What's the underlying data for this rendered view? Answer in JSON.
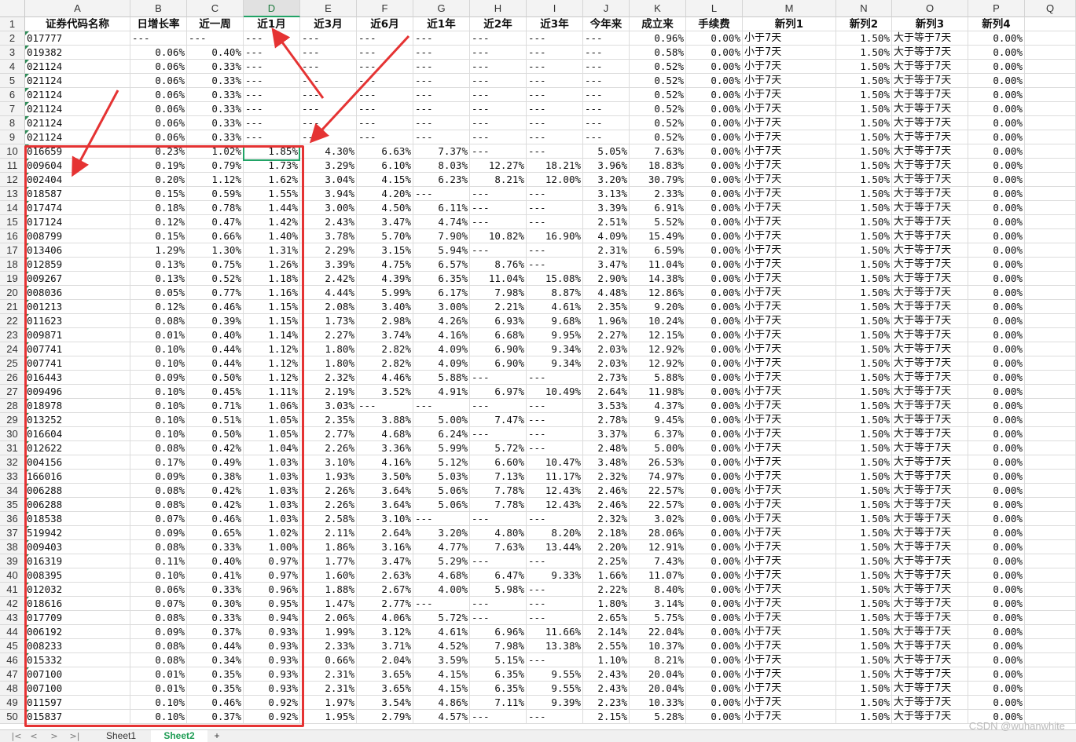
{
  "columns": [
    "A",
    "B",
    "C",
    "D",
    "E",
    "F",
    "G",
    "H",
    "I",
    "J",
    "K",
    "L",
    "M",
    "N",
    "O",
    "P",
    "Q"
  ],
  "active_column": "D",
  "header_row": [
    "证券代码名称",
    "日增长率",
    "近一周",
    "近1月",
    "近3月",
    "近6月",
    "近1年",
    "近2年",
    "近3年",
    "今年来",
    "成立来",
    "手续费",
    "新列1",
    "新列2",
    "新列3",
    "新列4"
  ],
  "rows": [
    [
      "017777",
      "---",
      "---",
      "---",
      "---",
      "---",
      "---",
      "---",
      "---",
      "---",
      "0.96%",
      "0.00%",
      "小于7天",
      "1.50%",
      "大于等于7天",
      "0.00%"
    ],
    [
      "019382",
      "0.06%",
      "0.40%",
      "---",
      "---",
      "---",
      "---",
      "---",
      "---",
      "---",
      "0.58%",
      "0.00%",
      "小于7天",
      "1.50%",
      "大于等于7天",
      "0.00%"
    ],
    [
      "021124",
      "0.06%",
      "0.33%",
      "---",
      "---",
      "---",
      "---",
      "---",
      "---",
      "---",
      "0.52%",
      "0.00%",
      "小于7天",
      "1.50%",
      "大于等于7天",
      "0.00%"
    ],
    [
      "021124",
      "0.06%",
      "0.33%",
      "---",
      "---",
      "---",
      "---",
      "---",
      "---",
      "---",
      "0.52%",
      "0.00%",
      "小于7天",
      "1.50%",
      "大于等于7天",
      "0.00%"
    ],
    [
      "021124",
      "0.06%",
      "0.33%",
      "---",
      "---",
      "---",
      "---",
      "---",
      "---",
      "---",
      "0.52%",
      "0.00%",
      "小于7天",
      "1.50%",
      "大于等于7天",
      "0.00%"
    ],
    [
      "021124",
      "0.06%",
      "0.33%",
      "---",
      "---",
      "---",
      "---",
      "---",
      "---",
      "---",
      "0.52%",
      "0.00%",
      "小于7天",
      "1.50%",
      "大于等于7天",
      "0.00%"
    ],
    [
      "021124",
      "0.06%",
      "0.33%",
      "---",
      "---",
      "---",
      "---",
      "---",
      "---",
      "---",
      "0.52%",
      "0.00%",
      "小于7天",
      "1.50%",
      "大于等于7天",
      "0.00%"
    ],
    [
      "021124",
      "0.06%",
      "0.33%",
      "---",
      "---",
      "---",
      "---",
      "---",
      "---",
      "---",
      "0.52%",
      "0.00%",
      "小于7天",
      "1.50%",
      "大于等于7天",
      "0.00%"
    ],
    [
      "016659",
      "0.23%",
      "1.02%",
      "1.85%",
      "4.30%",
      "6.63%",
      "7.37%",
      "---",
      "---",
      "5.05%",
      "7.63%",
      "0.00%",
      "小于7天",
      "1.50%",
      "大于等于7天",
      "0.00%"
    ],
    [
      "009604",
      "0.19%",
      "0.79%",
      "1.73%",
      "3.29%",
      "6.10%",
      "8.03%",
      "12.27%",
      "18.21%",
      "3.96%",
      "18.83%",
      "0.00%",
      "小于7天",
      "1.50%",
      "大于等于7天",
      "0.00%"
    ],
    [
      "002404",
      "0.20%",
      "1.12%",
      "1.62%",
      "3.04%",
      "4.15%",
      "6.23%",
      "8.21%",
      "12.00%",
      "3.20%",
      "30.79%",
      "0.00%",
      "小于7天",
      "1.50%",
      "大于等于7天",
      "0.00%"
    ],
    [
      "018587",
      "0.15%",
      "0.59%",
      "1.55%",
      "3.94%",
      "4.20%",
      "---",
      "---",
      "---",
      "3.13%",
      "2.33%",
      "0.00%",
      "小于7天",
      "1.50%",
      "大于等于7天",
      "0.00%"
    ],
    [
      "017474",
      "0.18%",
      "0.78%",
      "1.44%",
      "3.00%",
      "4.50%",
      "6.11%",
      "---",
      "---",
      "3.39%",
      "6.91%",
      "0.00%",
      "小于7天",
      "1.50%",
      "大于等于7天",
      "0.00%"
    ],
    [
      "017124",
      "0.12%",
      "0.47%",
      "1.42%",
      "2.43%",
      "3.47%",
      "4.74%",
      "---",
      "---",
      "2.51%",
      "5.52%",
      "0.00%",
      "小于7天",
      "1.50%",
      "大于等于7天",
      "0.00%"
    ],
    [
      "008799",
      "0.15%",
      "0.66%",
      "1.40%",
      "3.78%",
      "5.70%",
      "7.90%",
      "10.82%",
      "16.90%",
      "4.09%",
      "15.49%",
      "0.00%",
      "小于7天",
      "1.50%",
      "大于等于7天",
      "0.00%"
    ],
    [
      "013406",
      "1.29%",
      "1.30%",
      "1.31%",
      "2.29%",
      "3.15%",
      "5.94%",
      "---",
      "---",
      "2.31%",
      "6.59%",
      "0.00%",
      "小于7天",
      "1.50%",
      "大于等于7天",
      "0.00%"
    ],
    [
      "012859",
      "0.13%",
      "0.75%",
      "1.26%",
      "3.39%",
      "4.75%",
      "6.57%",
      "8.76%",
      "---",
      "3.47%",
      "11.04%",
      "0.00%",
      "小于7天",
      "1.50%",
      "大于等于7天",
      "0.00%"
    ],
    [
      "009267",
      "0.13%",
      "0.52%",
      "1.18%",
      "2.42%",
      "4.39%",
      "6.35%",
      "11.04%",
      "15.08%",
      "2.90%",
      "14.38%",
      "0.00%",
      "小于7天",
      "1.50%",
      "大于等于7天",
      "0.00%"
    ],
    [
      "008036",
      "0.05%",
      "0.77%",
      "1.16%",
      "4.44%",
      "5.99%",
      "6.17%",
      "7.98%",
      "8.87%",
      "4.48%",
      "12.86%",
      "0.00%",
      "小于7天",
      "1.50%",
      "大于等于7天",
      "0.00%"
    ],
    [
      "001213",
      "0.12%",
      "0.46%",
      "1.15%",
      "2.08%",
      "3.40%",
      "3.00%",
      "2.21%",
      "4.61%",
      "2.35%",
      "9.20%",
      "0.00%",
      "小于7天",
      "1.50%",
      "大于等于7天",
      "0.00%"
    ],
    [
      "011623",
      "0.08%",
      "0.39%",
      "1.15%",
      "1.73%",
      "2.98%",
      "4.26%",
      "6.93%",
      "9.68%",
      "1.96%",
      "10.24%",
      "0.00%",
      "小于7天",
      "1.50%",
      "大于等于7天",
      "0.00%"
    ],
    [
      "009871",
      "0.01%",
      "0.40%",
      "1.14%",
      "2.27%",
      "3.74%",
      "4.16%",
      "6.68%",
      "9.95%",
      "2.27%",
      "12.15%",
      "0.00%",
      "小于7天",
      "1.50%",
      "大于等于7天",
      "0.00%"
    ],
    [
      "007741",
      "0.10%",
      "0.44%",
      "1.12%",
      "1.80%",
      "2.82%",
      "4.09%",
      "6.90%",
      "9.34%",
      "2.03%",
      "12.92%",
      "0.00%",
      "小于7天",
      "1.50%",
      "大于等于7天",
      "0.00%"
    ],
    [
      "007741",
      "0.10%",
      "0.44%",
      "1.12%",
      "1.80%",
      "2.82%",
      "4.09%",
      "6.90%",
      "9.34%",
      "2.03%",
      "12.92%",
      "0.00%",
      "小于7天",
      "1.50%",
      "大于等于7天",
      "0.00%"
    ],
    [
      "016443",
      "0.09%",
      "0.50%",
      "1.12%",
      "2.32%",
      "4.46%",
      "5.88%",
      "---",
      "---",
      "2.73%",
      "5.88%",
      "0.00%",
      "小于7天",
      "1.50%",
      "大于等于7天",
      "0.00%"
    ],
    [
      "009496",
      "0.10%",
      "0.45%",
      "1.11%",
      "2.19%",
      "3.52%",
      "4.91%",
      "6.97%",
      "10.49%",
      "2.64%",
      "11.98%",
      "0.00%",
      "小于7天",
      "1.50%",
      "大于等于7天",
      "0.00%"
    ],
    [
      "018978",
      "0.10%",
      "0.71%",
      "1.06%",
      "3.03%",
      "---",
      "---",
      "---",
      "---",
      "3.53%",
      "4.37%",
      "0.00%",
      "小于7天",
      "1.50%",
      "大于等于7天",
      "0.00%"
    ],
    [
      "013252",
      "0.10%",
      "0.51%",
      "1.05%",
      "2.35%",
      "3.88%",
      "5.00%",
      "7.47%",
      "---",
      "2.78%",
      "9.45%",
      "0.00%",
      "小于7天",
      "1.50%",
      "大于等于7天",
      "0.00%"
    ],
    [
      "016604",
      "0.10%",
      "0.50%",
      "1.05%",
      "2.77%",
      "4.68%",
      "6.24%",
      "---",
      "---",
      "3.37%",
      "6.37%",
      "0.00%",
      "小于7天",
      "1.50%",
      "大于等于7天",
      "0.00%"
    ],
    [
      "012622",
      "0.08%",
      "0.42%",
      "1.04%",
      "2.26%",
      "3.36%",
      "5.99%",
      "5.72%",
      "---",
      "2.48%",
      "5.00%",
      "0.00%",
      "小于7天",
      "1.50%",
      "大于等于7天",
      "0.00%"
    ],
    [
      "004156",
      "0.17%",
      "0.49%",
      "1.03%",
      "3.10%",
      "4.16%",
      "5.12%",
      "6.60%",
      "10.47%",
      "3.48%",
      "26.53%",
      "0.00%",
      "小于7天",
      "1.50%",
      "大于等于7天",
      "0.00%"
    ],
    [
      "166016",
      "0.09%",
      "0.38%",
      "1.03%",
      "1.93%",
      "3.50%",
      "5.03%",
      "7.13%",
      "11.17%",
      "2.32%",
      "74.97%",
      "0.00%",
      "小于7天",
      "1.50%",
      "大于等于7天",
      "0.00%"
    ],
    [
      "006288",
      "0.08%",
      "0.42%",
      "1.03%",
      "2.26%",
      "3.64%",
      "5.06%",
      "7.78%",
      "12.43%",
      "2.46%",
      "22.57%",
      "0.00%",
      "小于7天",
      "1.50%",
      "大于等于7天",
      "0.00%"
    ],
    [
      "006288",
      "0.08%",
      "0.42%",
      "1.03%",
      "2.26%",
      "3.64%",
      "5.06%",
      "7.78%",
      "12.43%",
      "2.46%",
      "22.57%",
      "0.00%",
      "小于7天",
      "1.50%",
      "大于等于7天",
      "0.00%"
    ],
    [
      "018538",
      "0.07%",
      "0.46%",
      "1.03%",
      "2.58%",
      "3.10%",
      "---",
      "---",
      "---",
      "2.32%",
      "3.02%",
      "0.00%",
      "小于7天",
      "1.50%",
      "大于等于7天",
      "0.00%"
    ],
    [
      "519942",
      "0.09%",
      "0.65%",
      "1.02%",
      "2.11%",
      "2.64%",
      "3.20%",
      "4.80%",
      "8.20%",
      "2.18%",
      "28.06%",
      "0.00%",
      "小于7天",
      "1.50%",
      "大于等于7天",
      "0.00%"
    ],
    [
      "009403",
      "0.08%",
      "0.33%",
      "1.00%",
      "1.86%",
      "3.16%",
      "4.77%",
      "7.63%",
      "13.44%",
      "2.20%",
      "12.91%",
      "0.00%",
      "小于7天",
      "1.50%",
      "大于等于7天",
      "0.00%"
    ],
    [
      "016319",
      "0.11%",
      "0.40%",
      "0.97%",
      "1.77%",
      "3.47%",
      "5.29%",
      "---",
      "---",
      "2.25%",
      "7.43%",
      "0.00%",
      "小于7天",
      "1.50%",
      "大于等于7天",
      "0.00%"
    ],
    [
      "008395",
      "0.10%",
      "0.41%",
      "0.97%",
      "1.60%",
      "2.63%",
      "4.68%",
      "6.47%",
      "9.33%",
      "1.66%",
      "11.07%",
      "0.00%",
      "小于7天",
      "1.50%",
      "大于等于7天",
      "0.00%"
    ],
    [
      "012032",
      "0.06%",
      "0.33%",
      "0.96%",
      "1.88%",
      "2.67%",
      "4.00%",
      "5.98%",
      "---",
      "2.22%",
      "8.40%",
      "0.00%",
      "小于7天",
      "1.50%",
      "大于等于7天",
      "0.00%"
    ],
    [
      "018616",
      "0.07%",
      "0.30%",
      "0.95%",
      "1.47%",
      "2.77%",
      "---",
      "---",
      "---",
      "1.80%",
      "3.14%",
      "0.00%",
      "小于7天",
      "1.50%",
      "大于等于7天",
      "0.00%"
    ],
    [
      "017709",
      "0.08%",
      "0.33%",
      "0.94%",
      "2.06%",
      "4.06%",
      "5.72%",
      "---",
      "---",
      "2.65%",
      "5.75%",
      "0.00%",
      "小于7天",
      "1.50%",
      "大于等于7天",
      "0.00%"
    ],
    [
      "006192",
      "0.09%",
      "0.37%",
      "0.93%",
      "1.99%",
      "3.12%",
      "4.61%",
      "6.96%",
      "11.66%",
      "2.14%",
      "22.04%",
      "0.00%",
      "小于7天",
      "1.50%",
      "大于等于7天",
      "0.00%"
    ],
    [
      "008233",
      "0.08%",
      "0.44%",
      "0.93%",
      "2.33%",
      "3.71%",
      "4.52%",
      "7.98%",
      "13.38%",
      "2.55%",
      "10.37%",
      "0.00%",
      "小于7天",
      "1.50%",
      "大于等于7天",
      "0.00%"
    ],
    [
      "015332",
      "0.08%",
      "0.34%",
      "0.93%",
      "0.66%",
      "2.04%",
      "3.59%",
      "5.15%",
      "---",
      "1.10%",
      "8.21%",
      "0.00%",
      "小于7天",
      "1.50%",
      "大于等于7天",
      "0.00%"
    ],
    [
      "007100",
      "0.01%",
      "0.35%",
      "0.93%",
      "2.31%",
      "3.65%",
      "4.15%",
      "6.35%",
      "9.55%",
      "2.43%",
      "20.04%",
      "0.00%",
      "小于7天",
      "1.50%",
      "大于等于7天",
      "0.00%"
    ],
    [
      "007100",
      "0.01%",
      "0.35%",
      "0.93%",
      "2.31%",
      "3.65%",
      "4.15%",
      "6.35%",
      "9.55%",
      "2.43%",
      "20.04%",
      "0.00%",
      "小于7天",
      "1.50%",
      "大于等于7天",
      "0.00%"
    ],
    [
      "011597",
      "0.10%",
      "0.46%",
      "0.92%",
      "1.97%",
      "3.54%",
      "4.86%",
      "7.11%",
      "9.39%",
      "2.23%",
      "10.33%",
      "0.00%",
      "小于7天",
      "1.50%",
      "大于等于7天",
      "0.00%"
    ],
    [
      "015837",
      "0.10%",
      "0.37%",
      "0.92%",
      "1.95%",
      "2.79%",
      "4.57%",
      "---",
      "---",
      "2.15%",
      "5.28%",
      "0.00%",
      "小于7天",
      "1.50%",
      "大于等于7天",
      "0.00%"
    ]
  ],
  "sheet_tabs": [
    {
      "label": "Sheet1",
      "active": false
    },
    {
      "label": "Sheet2",
      "active": true
    }
  ],
  "add_sheet_label": "+",
  "nav_glyphs": [
    "|<",
    "<",
    ">",
    ">|"
  ],
  "watermark": "CSDN @wuhanwhite",
  "colors": {
    "annotation_red": "#e53333",
    "selection_green": "#21a366"
  }
}
